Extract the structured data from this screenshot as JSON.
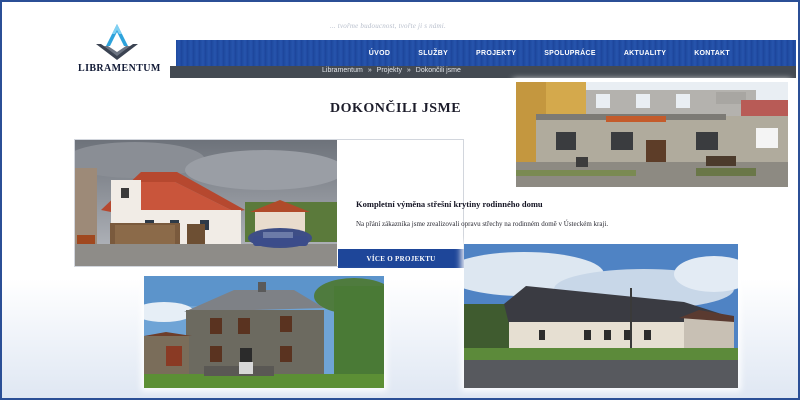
{
  "header": {
    "tagline": "... tvořme budoucnost, tvořte ji s námi.",
    "brand": "LIBRAMENTUM",
    "brand_color": "#111a36",
    "accent_color": "#1e4699",
    "logo_icon": "compass-square-icon"
  },
  "nav": {
    "items": [
      {
        "label": "ÚVOD"
      },
      {
        "label": "SLUŽBY"
      },
      {
        "label": "PROJEKTY"
      },
      {
        "label": "SPOLUPRÁCE"
      },
      {
        "label": "AKTUALITY"
      },
      {
        "label": "KONTAKT"
      }
    ]
  },
  "breadcrumb": {
    "items": [
      "Libramentum",
      "Projekty",
      "Dokončili jsme"
    ],
    "separator": "»"
  },
  "page": {
    "title": "DOKONČILI JSME"
  },
  "project": {
    "title": "Kompletní výměna střešní krytiny rodinného domu",
    "description": "Na přání zákazníka jsme zrealizovali opravu střechy na rodinném domě v Ústeckém kraji.",
    "button_label": "VÍCE O PROJEKTU"
  }
}
